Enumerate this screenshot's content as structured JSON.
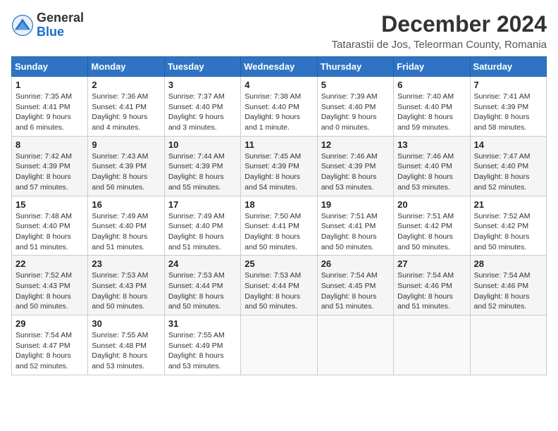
{
  "header": {
    "logo_general": "General",
    "logo_blue": "Blue",
    "month_year": "December 2024",
    "location": "Tatarastii de Jos, Teleorman County, Romania"
  },
  "days_of_week": [
    "Sunday",
    "Monday",
    "Tuesday",
    "Wednesday",
    "Thursday",
    "Friday",
    "Saturday"
  ],
  "weeks": [
    [
      {
        "day": "1",
        "info": "Sunrise: 7:35 AM\nSunset: 4:41 PM\nDaylight: 9 hours and 6 minutes."
      },
      {
        "day": "2",
        "info": "Sunrise: 7:36 AM\nSunset: 4:41 PM\nDaylight: 9 hours and 4 minutes."
      },
      {
        "day": "3",
        "info": "Sunrise: 7:37 AM\nSunset: 4:40 PM\nDaylight: 9 hours and 3 minutes."
      },
      {
        "day": "4",
        "info": "Sunrise: 7:38 AM\nSunset: 4:40 PM\nDaylight: 9 hours and 1 minute."
      },
      {
        "day": "5",
        "info": "Sunrise: 7:39 AM\nSunset: 4:40 PM\nDaylight: 9 hours and 0 minutes."
      },
      {
        "day": "6",
        "info": "Sunrise: 7:40 AM\nSunset: 4:40 PM\nDaylight: 8 hours and 59 minutes."
      },
      {
        "day": "7",
        "info": "Sunrise: 7:41 AM\nSunset: 4:39 PM\nDaylight: 8 hours and 58 minutes."
      }
    ],
    [
      {
        "day": "8",
        "info": "Sunrise: 7:42 AM\nSunset: 4:39 PM\nDaylight: 8 hours and 57 minutes."
      },
      {
        "day": "9",
        "info": "Sunrise: 7:43 AM\nSunset: 4:39 PM\nDaylight: 8 hours and 56 minutes."
      },
      {
        "day": "10",
        "info": "Sunrise: 7:44 AM\nSunset: 4:39 PM\nDaylight: 8 hours and 55 minutes."
      },
      {
        "day": "11",
        "info": "Sunrise: 7:45 AM\nSunset: 4:39 PM\nDaylight: 8 hours and 54 minutes."
      },
      {
        "day": "12",
        "info": "Sunrise: 7:46 AM\nSunset: 4:39 PM\nDaylight: 8 hours and 53 minutes."
      },
      {
        "day": "13",
        "info": "Sunrise: 7:46 AM\nSunset: 4:40 PM\nDaylight: 8 hours and 53 minutes."
      },
      {
        "day": "14",
        "info": "Sunrise: 7:47 AM\nSunset: 4:40 PM\nDaylight: 8 hours and 52 minutes."
      }
    ],
    [
      {
        "day": "15",
        "info": "Sunrise: 7:48 AM\nSunset: 4:40 PM\nDaylight: 8 hours and 51 minutes."
      },
      {
        "day": "16",
        "info": "Sunrise: 7:49 AM\nSunset: 4:40 PM\nDaylight: 8 hours and 51 minutes."
      },
      {
        "day": "17",
        "info": "Sunrise: 7:49 AM\nSunset: 4:40 PM\nDaylight: 8 hours and 51 minutes."
      },
      {
        "day": "18",
        "info": "Sunrise: 7:50 AM\nSunset: 4:41 PM\nDaylight: 8 hours and 50 minutes."
      },
      {
        "day": "19",
        "info": "Sunrise: 7:51 AM\nSunset: 4:41 PM\nDaylight: 8 hours and 50 minutes."
      },
      {
        "day": "20",
        "info": "Sunrise: 7:51 AM\nSunset: 4:42 PM\nDaylight: 8 hours and 50 minutes."
      },
      {
        "day": "21",
        "info": "Sunrise: 7:52 AM\nSunset: 4:42 PM\nDaylight: 8 hours and 50 minutes."
      }
    ],
    [
      {
        "day": "22",
        "info": "Sunrise: 7:52 AM\nSunset: 4:43 PM\nDaylight: 8 hours and 50 minutes."
      },
      {
        "day": "23",
        "info": "Sunrise: 7:53 AM\nSunset: 4:43 PM\nDaylight: 8 hours and 50 minutes."
      },
      {
        "day": "24",
        "info": "Sunrise: 7:53 AM\nSunset: 4:44 PM\nDaylight: 8 hours and 50 minutes."
      },
      {
        "day": "25",
        "info": "Sunrise: 7:53 AM\nSunset: 4:44 PM\nDaylight: 8 hours and 50 minutes."
      },
      {
        "day": "26",
        "info": "Sunrise: 7:54 AM\nSunset: 4:45 PM\nDaylight: 8 hours and 51 minutes."
      },
      {
        "day": "27",
        "info": "Sunrise: 7:54 AM\nSunset: 4:46 PM\nDaylight: 8 hours and 51 minutes."
      },
      {
        "day": "28",
        "info": "Sunrise: 7:54 AM\nSunset: 4:46 PM\nDaylight: 8 hours and 52 minutes."
      }
    ],
    [
      {
        "day": "29",
        "info": "Sunrise: 7:54 AM\nSunset: 4:47 PM\nDaylight: 8 hours and 52 minutes."
      },
      {
        "day": "30",
        "info": "Sunrise: 7:55 AM\nSunset: 4:48 PM\nDaylight: 8 hours and 53 minutes."
      },
      {
        "day": "31",
        "info": "Sunrise: 7:55 AM\nSunset: 4:49 PM\nDaylight: 8 hours and 53 minutes."
      },
      {
        "day": "",
        "info": ""
      },
      {
        "day": "",
        "info": ""
      },
      {
        "day": "",
        "info": ""
      },
      {
        "day": "",
        "info": ""
      }
    ]
  ]
}
